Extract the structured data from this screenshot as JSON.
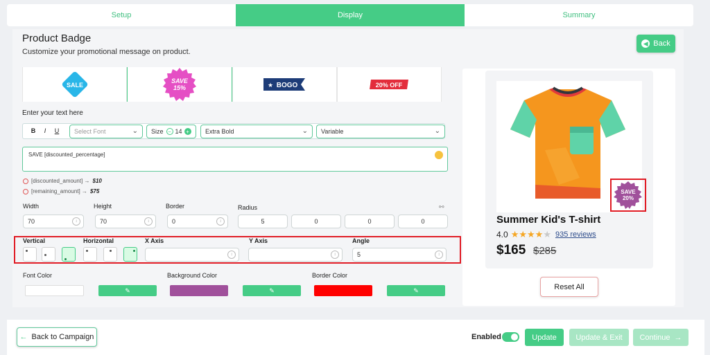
{
  "tabs": [
    "Setup",
    "Display",
    "Summary"
  ],
  "header": {
    "title": "Product Badge",
    "subtitle": "Customize your promotional message on product.",
    "back_label": "Back"
  },
  "badges": [
    {
      "text": "SALE",
      "color": "#29b6e8"
    },
    {
      "text": "SAVE 15%",
      "color": "#e54fc4"
    },
    {
      "text": "BOGO",
      "color": "#1d3c78"
    },
    {
      "text": "20% OFF",
      "color": "#e32d3c"
    }
  ],
  "text_section": {
    "label": "Enter your text here",
    "bold": "B",
    "italic": "I",
    "underline": "U",
    "font_placeholder": "Select Font",
    "size_label": "Size",
    "size_value": "14",
    "weight": "Extra Bold",
    "variable": "Variable",
    "text_value": "SAVE [discounted_percentage]",
    "hints": [
      {
        "key": "[discounted_amount] →",
        "value": "$10"
      },
      {
        "key": "[remaining_amount] →",
        "value": "$75"
      }
    ]
  },
  "dimensions": {
    "width_label": "Width",
    "width": "70",
    "height_label": "Height",
    "height": "70",
    "border_label": "Border",
    "border": "0",
    "radius_label": "Radius",
    "radius": [
      "5",
      "0",
      "0",
      "0"
    ]
  },
  "position": {
    "vertical_label": "Vertical",
    "horizontal_label": "Horizontal",
    "x_label": "X Axis",
    "x_value": "",
    "y_label": "Y Axis",
    "y_value": "",
    "angle_label": "Angle",
    "angle": "5"
  },
  "colors": {
    "font_label": "Font Color",
    "font_value": "#ffffff",
    "bg_label": "Background Color",
    "bg_value": "#a0509b",
    "border_label": "Border Color",
    "border_value": "#ff0000"
  },
  "preview": {
    "badge_line1": "SAVE",
    "badge_line2": "20%",
    "product_name": "Summer Kid's T-shirt",
    "rating": "4.0",
    "reviews": "935 reviews",
    "price": "$165",
    "old_price": "$285",
    "reset_label": "Reset All"
  },
  "footer": {
    "back_campaign": "Back to Campaign",
    "enabled_label": "Enabled",
    "update": "Update",
    "update_exit": "Update & Exit",
    "continue": "Continue"
  }
}
